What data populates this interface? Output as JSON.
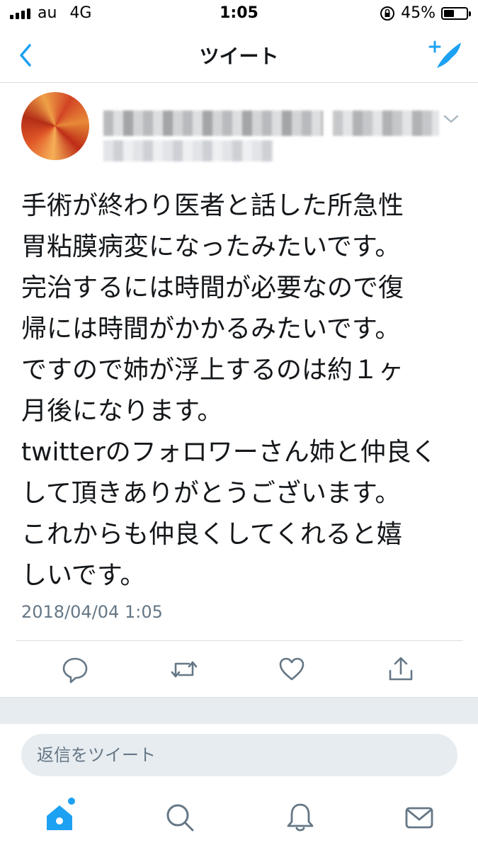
{
  "status_bar": {
    "carrier": "au",
    "network": "4G",
    "time": "1:05",
    "battery_percent": "45%",
    "battery_level": 0.45
  },
  "nav": {
    "title": "ツイート",
    "back_icon": "chevron-left-icon",
    "compose_icon": "compose-tweet-icon"
  },
  "tweet": {
    "text": "手術が終わり医者と話した所急性\n胃粘膜病変になったみたいです。\n完治するには時間が必要なので復\n帰には時間がかかるみたいです。\nですので姉が浮上するのは約１ヶ\n月後になります。\ntwitterのフォロワーさん姉と仲良く\nして頂きありがとうございます。\nこれからも仲良くしてくれると嬉\nしいです。",
    "timestamp": "2018/04/04 1:05"
  },
  "reply": {
    "placeholder": "返信をツイート"
  },
  "colors": {
    "accent": "#1da1f2",
    "text_secondary": "#657786",
    "divider": "#d9dfe4",
    "band": "#e6ecf0"
  }
}
